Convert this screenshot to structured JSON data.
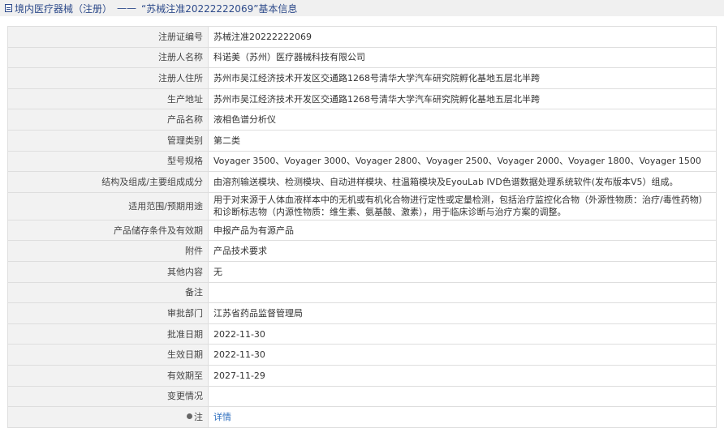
{
  "header": {
    "category": "境内医疗器械（注册）",
    "separator": "——",
    "title": "“苏械注准20222222069”基本信息"
  },
  "rows": [
    {
      "label": "注册证编号",
      "value": "苏械注准20222222069"
    },
    {
      "label": "注册人名称",
      "value": "科诺美（苏州）医疗器械科技有限公司"
    },
    {
      "label": "注册人住所",
      "value": "苏州市吴江经济技术开发区交通路1268号清华大学汽车研究院孵化基地五层北半跨"
    },
    {
      "label": "生产地址",
      "value": "苏州市吴江经济技术开发区交通路1268号清华大学汽车研究院孵化基地五层北半跨"
    },
    {
      "label": "产品名称",
      "value": "液相色谱分析仪"
    },
    {
      "label": "管理类别",
      "value": "第二类"
    },
    {
      "label": "型号规格",
      "value": "Voyager 3500、Voyager 3000、Voyager 2800、Voyager 2500、Voyager 2000、Voyager 1800、Voyager 1500"
    },
    {
      "label": "结构及组成/主要组成成分",
      "value": "由溶剂输送模块、检测模块、自动进样模块、柱温箱模块及EyouLab IVD色谱数据处理系统软件(发布版本V5）组成。"
    },
    {
      "label": "适用范围/预期用途",
      "value": "用于对来源于人体血液样本中的无机或有机化合物进行定性或定量检测，包括治疗监控化合物（外源性物质：治疗/毒性药物）和诊断标志物（内源性物质：维生素、氨基酸、激素），用于临床诊断与治疗方案的调整。"
    },
    {
      "label": "产品储存条件及有效期",
      "value": "申报产品为有源产品"
    },
    {
      "label": "附件",
      "value": "产品技术要求"
    },
    {
      "label": "其他内容",
      "value": "无"
    },
    {
      "label": "备注",
      "value": ""
    },
    {
      "label": "审批部门",
      "value": "江苏省药品监督管理局"
    },
    {
      "label": "批准日期",
      "value": "2022-11-30"
    },
    {
      "label": "生效日期",
      "value": "2022-11-30"
    },
    {
      "label": "有效期至",
      "value": "2027-11-29"
    },
    {
      "label": "变更情况",
      "value": ""
    }
  ],
  "note": {
    "label": "注",
    "link_text": "详情",
    "icon": "location-pin-icon"
  },
  "colors": {
    "title_text": "#2d4a8a",
    "link": "#2f6fbf",
    "label_bg": "#f2f2f2",
    "border": "#dedede"
  }
}
